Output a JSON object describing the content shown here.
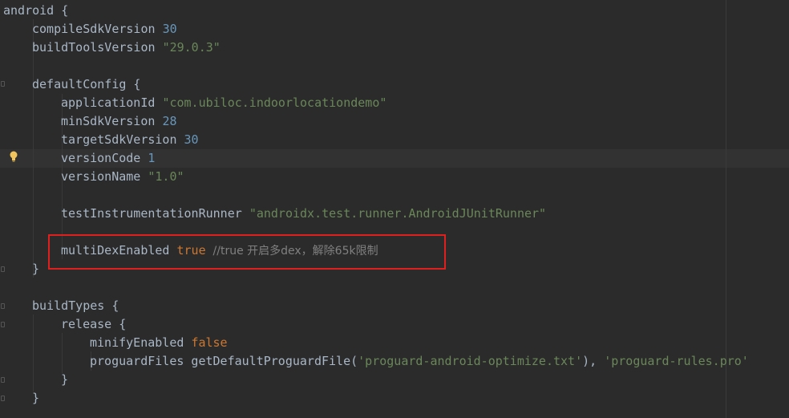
{
  "editor": {
    "lines": [
      {
        "id": "l1",
        "tokens": [
          {
            "t": "android {",
            "c": "id"
          }
        ]
      },
      {
        "id": "l2",
        "tokens": [
          {
            "t": "compileSdkVersion ",
            "c": "id"
          },
          {
            "t": "30",
            "c": "num"
          }
        ]
      },
      {
        "id": "l3",
        "tokens": [
          {
            "t": "buildToolsVersion ",
            "c": "id"
          },
          {
            "t": "\"29.0.3\"",
            "c": "str"
          }
        ]
      },
      {
        "id": "l4",
        "tokens": [
          {
            "t": "defaultConfig {",
            "c": "id"
          }
        ]
      },
      {
        "id": "l5",
        "tokens": [
          {
            "t": "applicationId ",
            "c": "id"
          },
          {
            "t": "\"com.ubiloc.indoorlocationdemo\"",
            "c": "str"
          }
        ]
      },
      {
        "id": "l6",
        "tokens": [
          {
            "t": "minSdkVersion ",
            "c": "id"
          },
          {
            "t": "28",
            "c": "num"
          }
        ]
      },
      {
        "id": "l7",
        "tokens": [
          {
            "t": "targetSdkVersion ",
            "c": "id"
          },
          {
            "t": "30",
            "c": "num"
          }
        ]
      },
      {
        "id": "l8",
        "tokens": [
          {
            "t": "versionCode ",
            "c": "id"
          },
          {
            "t": "1",
            "c": "num"
          }
        ]
      },
      {
        "id": "l9",
        "tokens": [
          {
            "t": "versionName ",
            "c": "id"
          },
          {
            "t": "\"1.0\"",
            "c": "str"
          }
        ]
      },
      {
        "id": "l10",
        "tokens": [
          {
            "t": "testInstrumentationRunner ",
            "c": "id"
          },
          {
            "t": "\"androidx.test.runner.AndroidJUnitRunner\"",
            "c": "str"
          }
        ]
      },
      {
        "id": "l11",
        "tokens": [
          {
            "t": "multiDexEnabled ",
            "c": "id"
          },
          {
            "t": "true",
            "c": "kw"
          },
          {
            "t": "  //true 开启多dex，解除65k限制",
            "c": "cmt"
          }
        ]
      },
      {
        "id": "l12",
        "tokens": [
          {
            "t": "}",
            "c": "id"
          }
        ]
      },
      {
        "id": "l13",
        "tokens": [
          {
            "t": "buildTypes {",
            "c": "id"
          }
        ]
      },
      {
        "id": "l14",
        "tokens": [
          {
            "t": "release {",
            "c": "id"
          }
        ]
      },
      {
        "id": "l15",
        "tokens": [
          {
            "t": "minifyEnabled ",
            "c": "id"
          },
          {
            "t": "false",
            "c": "kw"
          }
        ]
      },
      {
        "id": "l16",
        "tokens": [
          {
            "t": "proguardFiles getDefaultProguardFile(",
            "c": "id"
          },
          {
            "t": "'proguard-android-optimize.txt'",
            "c": "str"
          },
          {
            "t": "), ",
            "c": "id"
          },
          {
            "t": "'proguard-rules.pro'",
            "c": "str"
          }
        ]
      },
      {
        "id": "l17",
        "tokens": [
          {
            "t": "}",
            "c": "id"
          }
        ]
      },
      {
        "id": "l18",
        "tokens": [
          {
            "t": "}",
            "c": "id"
          }
        ]
      }
    ]
  },
  "colors": {
    "background": "#2b2b2b",
    "identifier": "#a9b7c6",
    "keyword": "#cc7832",
    "number": "#6897bb",
    "string": "#6a8759",
    "comment": "#808080",
    "highlight_box": "#e01f1f",
    "bulb": "#f2c55c"
  },
  "icons": {
    "intention": "lightbulb-icon",
    "fold": "fold-marker-icon"
  }
}
